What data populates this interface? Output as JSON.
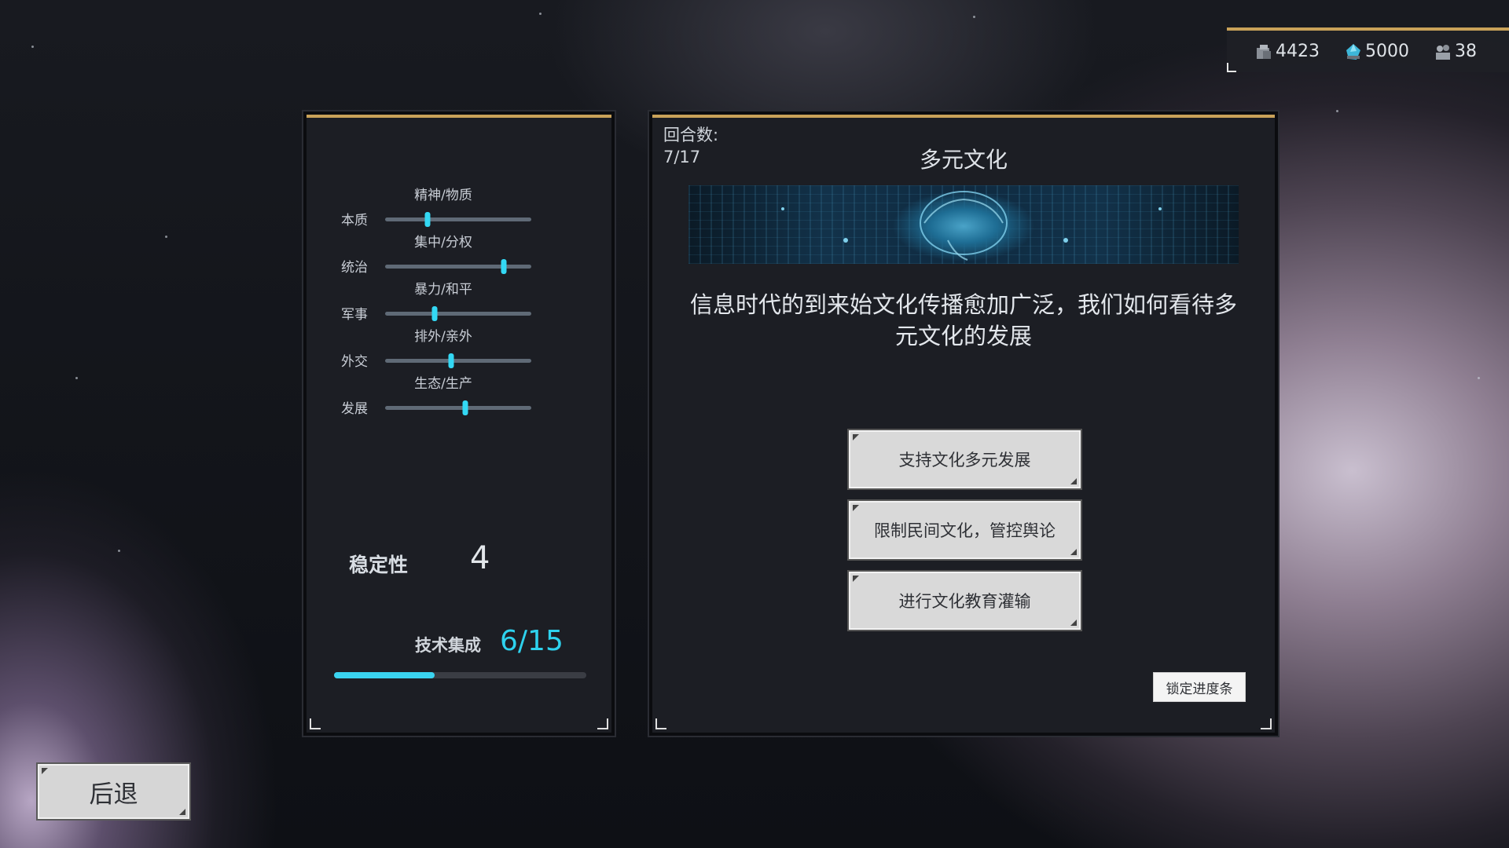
{
  "resources": [
    {
      "icon": "stone-resource-icon",
      "value": "4423"
    },
    {
      "icon": "energy-crystal-icon",
      "value": "5000"
    },
    {
      "icon": "population-icon",
      "value": "38"
    }
  ],
  "left_panel": {
    "sliders": [
      {
        "title": "精神/物质",
        "label": "本质",
        "position": 0.29
      },
      {
        "title": "集中/分权",
        "label": "统治",
        "position": 0.81
      },
      {
        "title": "暴力/和平",
        "label": "军事",
        "position": 0.34
      },
      {
        "title": "排外/亲外",
        "label": "外交",
        "position": 0.45
      },
      {
        "title": "生态/生产",
        "label": "发展",
        "position": 0.55
      }
    ],
    "stability_label": "稳定性",
    "stability_value": "4",
    "tech_label": "技术集成",
    "tech_value": "6/15",
    "tech_progress": 0.4
  },
  "event": {
    "round_label": "回合数:",
    "round_value": "7/17",
    "title": "多元文化",
    "description": "信息时代的到来始文化传播愈加广泛，我们如何看待多元文化的发展",
    "options": [
      "支持文化多元发展",
      "限制民间文化，管控舆论",
      "进行文化教育灌输"
    ],
    "lock_label": "锁定进度条"
  },
  "back_label": "后退",
  "colors": {
    "accent_gold": "#c9a259",
    "slider_knob": "#33d8f4",
    "tech_value": "#2ed2ee"
  }
}
